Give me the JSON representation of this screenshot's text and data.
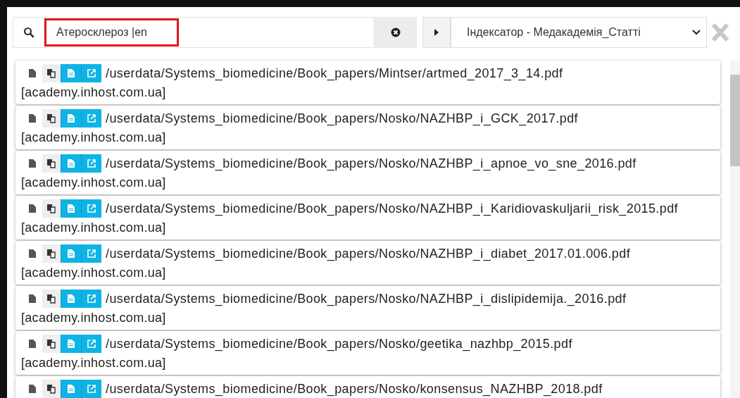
{
  "search": {
    "value": "Атеросклероз |en",
    "highlighted": true
  },
  "indexer_select": {
    "value": "Індексатор - Медакадемія_Статті"
  },
  "results": [
    {
      "path": "/userdata/Systems_biomedicine/Book_papers/Mintser/artmed_2017_3_14.pdf",
      "source": "[academy.inhost.com.ua]"
    },
    {
      "path": "/userdata/Systems_biomedicine/Book_papers/Nosko/NAZHBP_i_GCK_2017.pdf",
      "source": "[academy.inhost.com.ua]"
    },
    {
      "path": "/userdata/Systems_biomedicine/Book_papers/Nosko/NAZHBP_i_apnoe_vo_sne_2016.pdf",
      "source": "[academy.inhost.com.ua]"
    },
    {
      "path": "/userdata/Systems_biomedicine/Book_papers/Nosko/NAZHBP_i_Karidiovaskuljarii_risk_2015.pdf",
      "source": "[academy.inhost.com.ua]"
    },
    {
      "path": "/userdata/Systems_biomedicine/Book_papers/Nosko/NAZHBP_i_diabet_2017.01.006.pdf",
      "source": "[academy.inhost.com.ua]"
    },
    {
      "path": "/userdata/Systems_biomedicine/Book_papers/Nosko/NAZHBP_i_dislipidemija._2016.pdf",
      "source": "[academy.inhost.com.ua]"
    },
    {
      "path": "/userdata/Systems_biomedicine/Book_papers/Nosko/geetika_nazhbp_2015.pdf",
      "source": "[academy.inhost.com.ua]"
    },
    {
      "path": "/userdata/Systems_biomedicine/Book_papers/Nosko/konsensus_NAZHBP_2018.pdf"
    }
  ]
}
